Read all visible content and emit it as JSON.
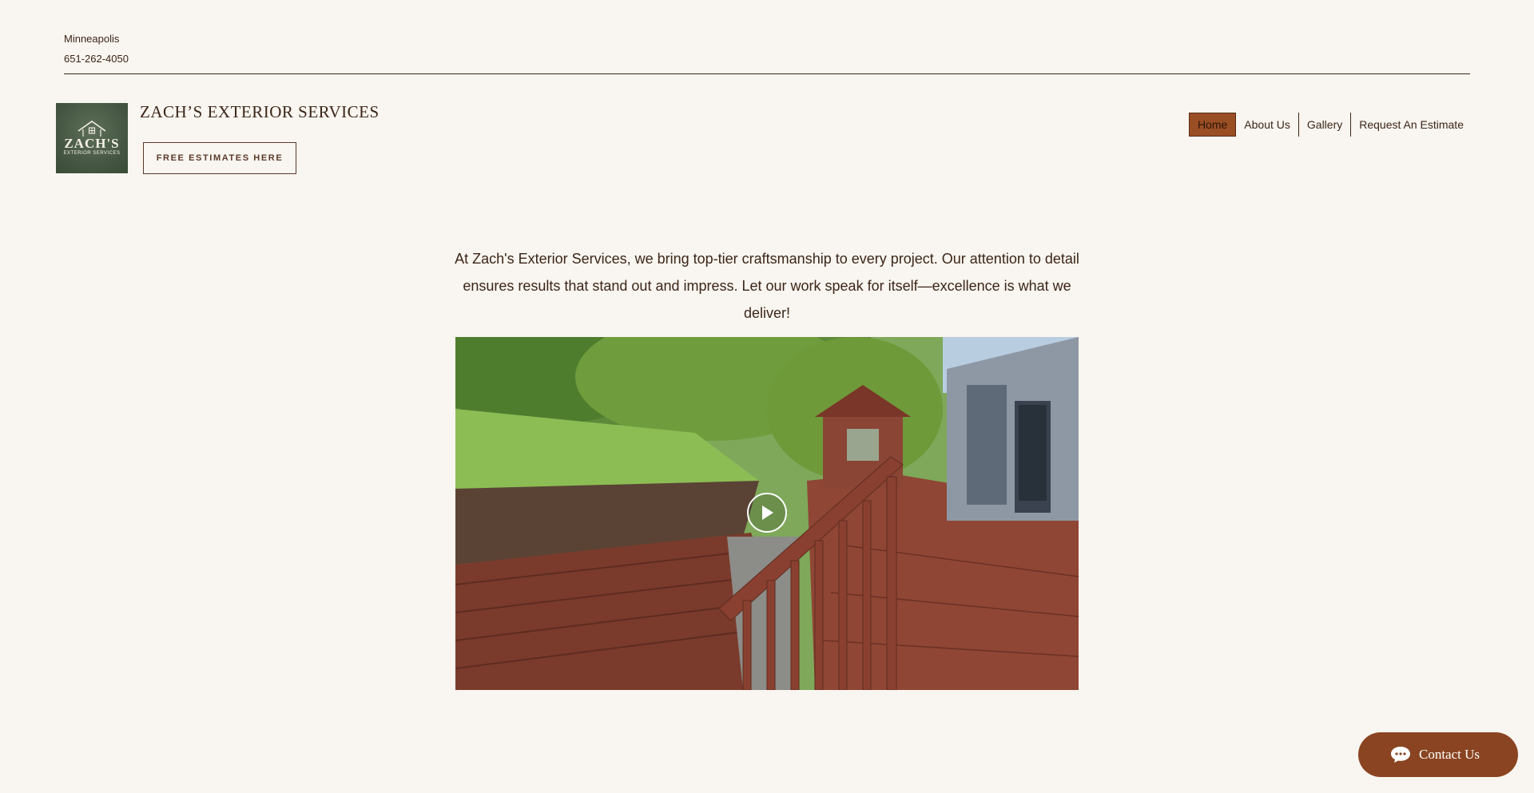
{
  "topbar": {
    "city": "Minneapolis",
    "phone": "651-262-4050"
  },
  "logo": {
    "line1": "ZACH'S",
    "line2": "EXTERIOR SERVICES"
  },
  "brand": {
    "name": "ZACH’S EXTERIOR SERVICES",
    "cta_label": "FREE ESTIMATES HERE"
  },
  "nav": {
    "items": [
      {
        "label": "Home"
      },
      {
        "label": "About Us"
      },
      {
        "label": "Gallery"
      },
      {
        "label": "Request An Estimate"
      }
    ]
  },
  "main": {
    "intro": "At Zach's Exterior Services, we bring top-tier craftsmanship to every project. Our attention to detail ensures results that stand out and impress. Let our work speak for itself—excellence is what we deliver!"
  },
  "chat": {
    "label": "Contact Us"
  },
  "colors": {
    "background": "#f9f5f0",
    "accent": "#9a4e24",
    "text": "#3b2618",
    "chat": "#8a4421"
  }
}
